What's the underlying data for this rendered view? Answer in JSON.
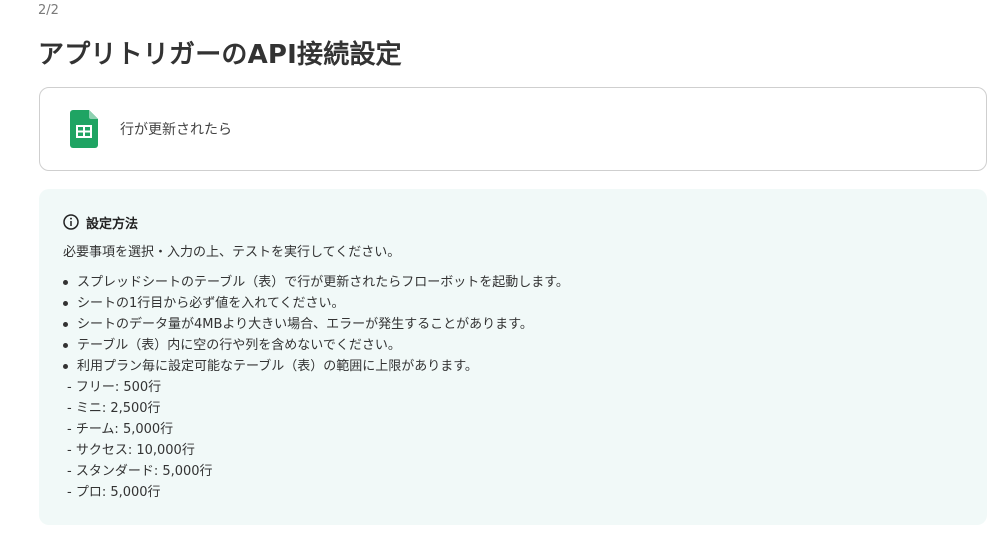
{
  "header": {
    "step": "2/2",
    "title": "アプリトリガーのAPI接続設定"
  },
  "trigger": {
    "icon": "google-sheets-icon",
    "label": "行が更新されたら"
  },
  "info": {
    "icon": "info-circle-icon",
    "heading": "設定方法",
    "intro": "必要事項を選択・入力の上、テストを実行してください。",
    "bullets": [
      "スプレッドシートのテーブル（表）で行が更新されたらフローボットを起動します。",
      "シートの1行目から必ず値を入れてください。",
      "シートのデータ量が4MBより大きい場合、エラーが発生することがあります。",
      "テーブル（表）内に空の行や列を含めないでください。",
      "利用プラン毎に設定可能なテーブル（表）の範囲に上限があります。"
    ],
    "plans": [
      "- フリー: 500行",
      "- ミニ: 2,500行",
      "- チーム: 5,000行",
      "- サクセス: 10,000行",
      "- スタンダード: 5,000行",
      "- プロ: 5,000行"
    ]
  },
  "colors": {
    "sheets_green": "#1fa463",
    "info_bg": "#f1f9f8"
  }
}
